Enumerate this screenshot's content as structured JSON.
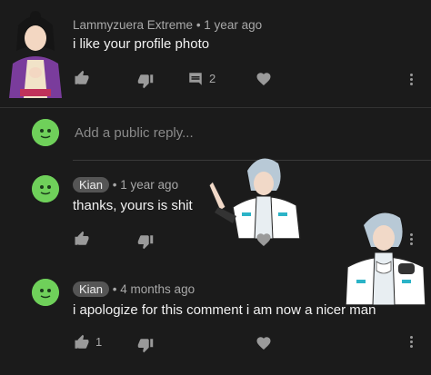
{
  "comment": {
    "author": "Lammyzuera Extreme",
    "time": "1 year ago",
    "text": "i like your profile photo",
    "reply_count": "2"
  },
  "reply_box": {
    "placeholder": "Add a public reply..."
  },
  "replies": [
    {
      "author": "Kian",
      "time": "1 year ago",
      "text": "thanks, yours is shit",
      "like_count": ""
    },
    {
      "author": "Kian",
      "time": "4 months ago",
      "text": "i apologize for this comment i am now a nicer man",
      "like_count": "1"
    }
  ],
  "icons": [
    "thumb-up-icon",
    "thumb-down-icon",
    "reply-icon",
    "heart-icon",
    "more-icon",
    "avatar"
  ],
  "colors": {
    "background": "#1b1b1b",
    "meta": "#a8a8a8",
    "badge": "#555555",
    "avatar_green": "#6fd05a"
  }
}
